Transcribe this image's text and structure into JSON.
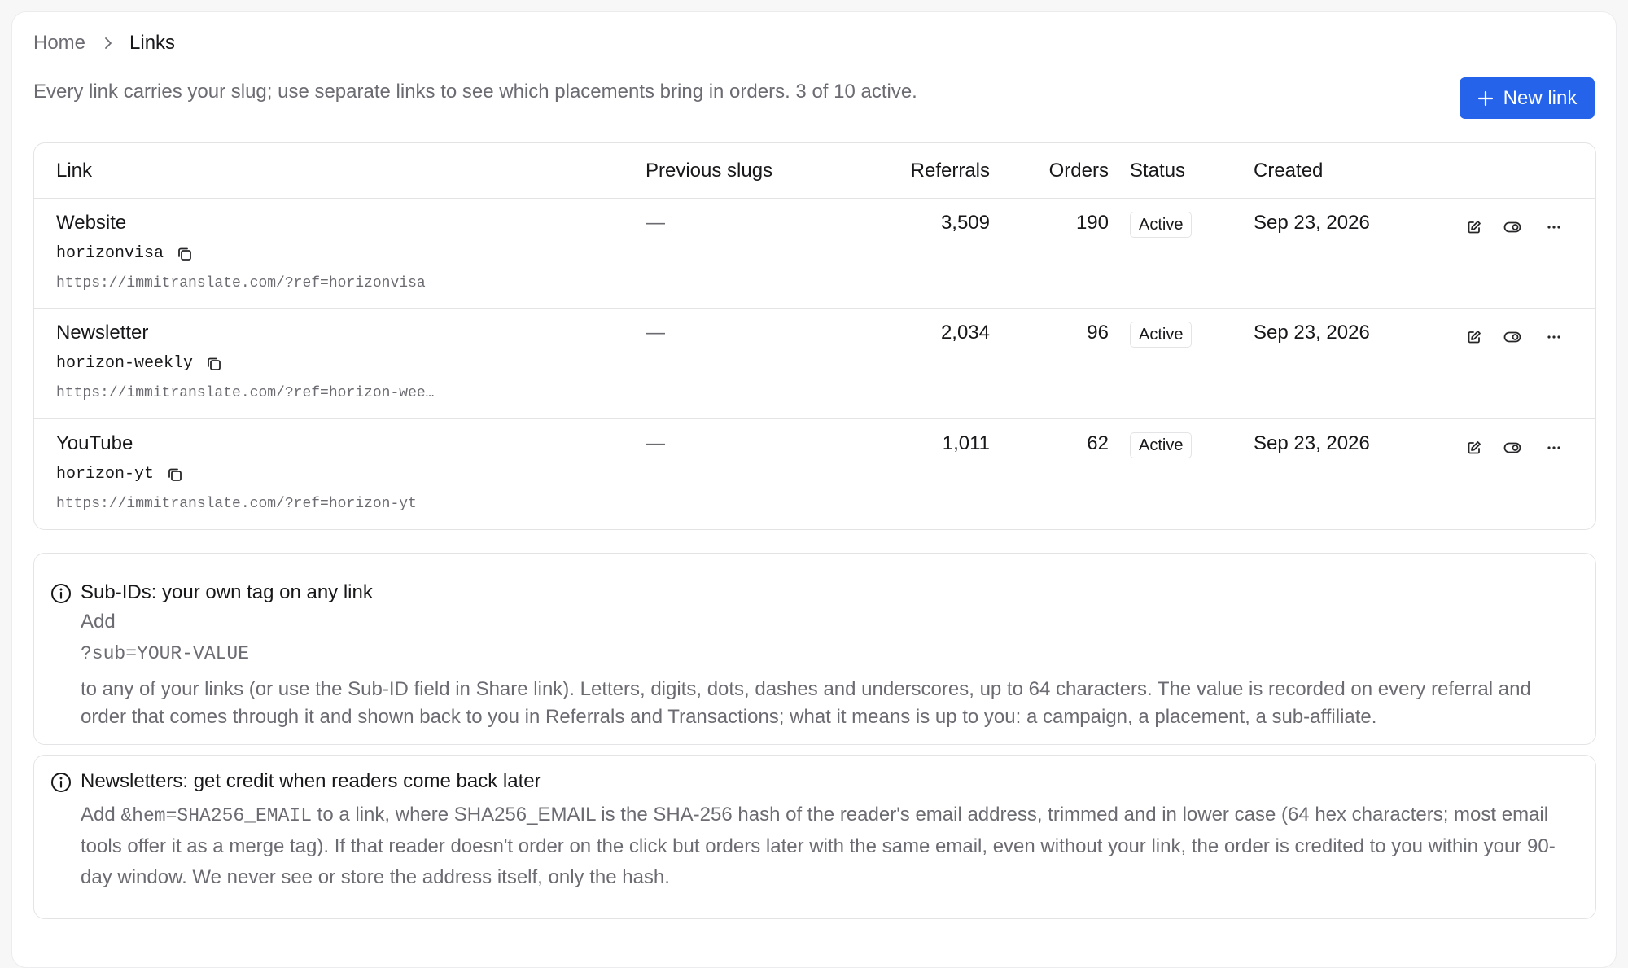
{
  "breadcrumb": {
    "home": "Home",
    "current": "Links"
  },
  "subtitle": "Every link carries your slug; use separate links to see which placements bring in orders. 3 of 10 active.",
  "new_link_button": "New link",
  "table": {
    "headers": {
      "link": "Link",
      "previous_slugs": "Previous slugs",
      "referrals": "Referrals",
      "orders": "Orders",
      "status": "Status",
      "created": "Created"
    },
    "rows": [
      {
        "name": "Website",
        "slug": "horizonvisa",
        "url": "https://immitranslate.com/?ref=horizonvisa",
        "previous_slugs": "—",
        "referrals": "3,509",
        "orders": "190",
        "status": "Active",
        "created": "Sep 23, 2026"
      },
      {
        "name": "Newsletter",
        "slug": "horizon-weekly",
        "url": "https://immitranslate.com/?ref=horizon-wee…",
        "previous_slugs": "—",
        "referrals": "2,034",
        "orders": "96",
        "status": "Active",
        "created": "Sep 23, 2026"
      },
      {
        "name": "YouTube",
        "slug": "horizon-yt",
        "url": "https://immitranslate.com/?ref=horizon-yt",
        "previous_slugs": "—",
        "referrals": "1,011",
        "orders": "62",
        "status": "Active",
        "created": "Sep 23, 2026"
      }
    ],
    "row_actions": {
      "edit": "edit-icon",
      "toggle": "toggle-icon",
      "more": "..."
    }
  },
  "subids_card": {
    "title": "Sub-IDs: your own tag on any link",
    "add": "Add",
    "code": "?sub=YOUR-VALUE",
    "body": "to any of your links (or use the Sub-ID field in Share link). Letters, digits, dots, dashes and underscores, up to 64 characters. The value is recorded on every referral and order that comes through it and shown back to you in Referrals and Transactions; what it means is up to you: a campaign, a placement, a sub-affiliate."
  },
  "newsletters_card": {
    "title": "Newsletters: get credit when readers come back later",
    "body_prefix": "Add ",
    "code1": "&hem=SHA256_EMAIL",
    "body_mid": " to a link, where SHA256_EMAIL is the SHA-256 hash of the reader's email address, trimmed and in lower case (64 hex characters; most email tools offer it as a merge tag). If that reader doesn't order on the click but orders later with the same email, even without your link, the order is credited to you within your 90-day window. We never see or store the address itself, only the hash."
  },
  "colors": {
    "accent": "#2563eb",
    "border": "#e4e4e7",
    "muted_text": "#6b6b72",
    "text": "#18181b"
  }
}
